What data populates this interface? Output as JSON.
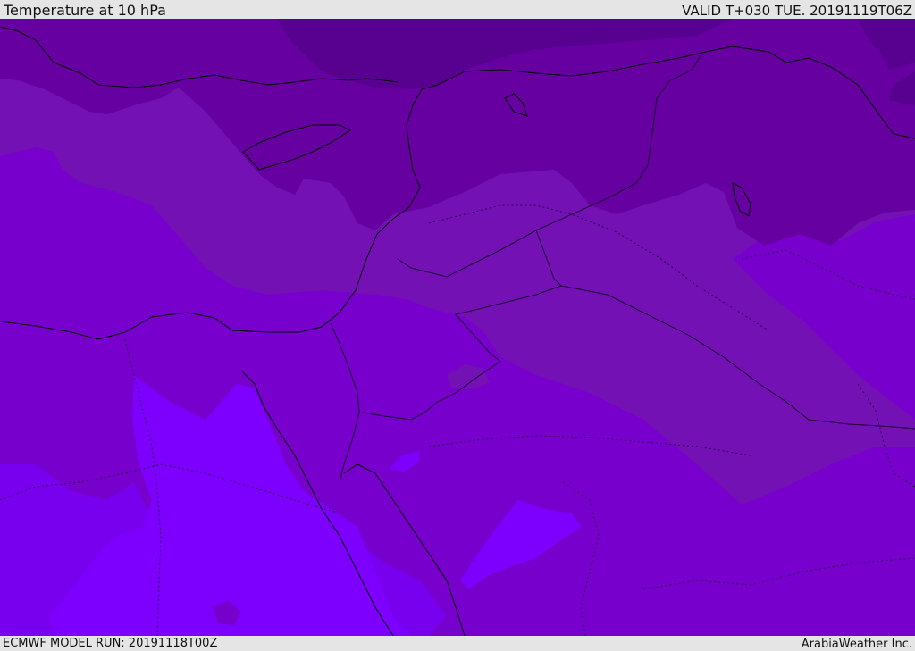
{
  "header": {
    "title": "Temperature at 10 hPa",
    "valid_time": "VALID T+030 TUE. 20191119T06Z"
  },
  "footer": {
    "model_run": "ECMWF MODEL RUN: 20191118T00Z",
    "credit": "ArabiaWeather Inc."
  },
  "colors": {
    "frame_background": "#e5e5e5",
    "shade_coldest": "#58008f",
    "shade_very_cold": "#6600a0",
    "shade_cold": "#7311b4",
    "shade_mid": "#7700cc",
    "shade_mild": "#7800ee",
    "shade_warmest": "#7d00ff",
    "coastline_color": "#000000",
    "boundary_color": "#1a0030"
  }
}
